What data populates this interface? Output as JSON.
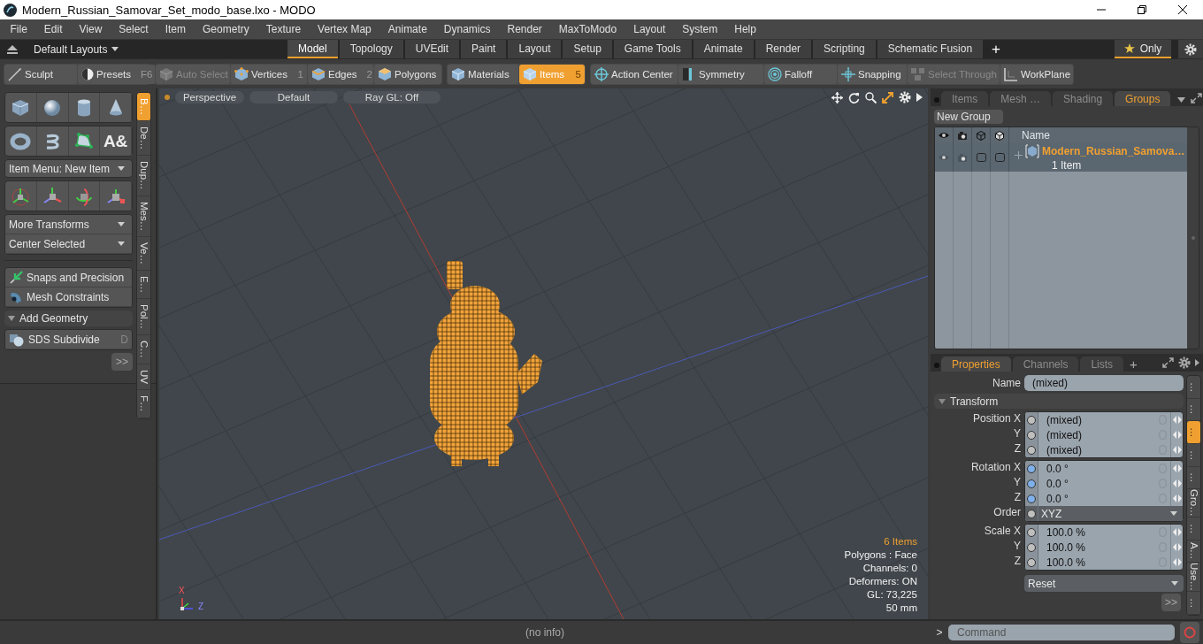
{
  "window": {
    "title": "Modern_Russian_Samovar_Set_modo_base.lxo - MODO"
  },
  "menu": [
    "File",
    "Edit",
    "View",
    "Select",
    "Item",
    "Geometry",
    "Texture",
    "Vertex Map",
    "Animate",
    "Dynamics",
    "Render",
    "MaxToModo",
    "Layout",
    "System",
    "Help"
  ],
  "layout_bar": {
    "layouts": "Default Layouts",
    "tabs": [
      {
        "label": "Model",
        "selected": true
      },
      {
        "label": "Topology",
        "selected": false
      },
      {
        "label": "UVEdit",
        "selected": false
      },
      {
        "label": "Paint",
        "selected": false
      },
      {
        "label": "Layout",
        "selected": false
      },
      {
        "label": "Setup",
        "selected": false
      },
      {
        "label": "Game Tools",
        "selected": false
      },
      {
        "label": "Animate",
        "selected": false
      },
      {
        "label": "Render",
        "selected": false
      },
      {
        "label": "Scripting",
        "selected": false
      },
      {
        "label": "Schematic Fusion",
        "selected": false
      }
    ],
    "add": "+",
    "only": "Only"
  },
  "toolbar": {
    "sculpt": "Sculpt",
    "presets": {
      "label": "Presets",
      "shortcut": "F6"
    },
    "mode_groups": [
      [
        {
          "label": "Auto Select",
          "disabled": true,
          "selected": false
        },
        {
          "label": "Vertices",
          "shortcut": "1",
          "disabled": false,
          "selected": false
        },
        {
          "label": "Edges",
          "shortcut": "2",
          "disabled": false,
          "selected": false
        },
        {
          "label": "Polygons",
          "disabled": false,
          "selected": false
        }
      ],
      [
        {
          "label": "Materials",
          "disabled": false,
          "selected": false
        },
        {
          "label": "Items",
          "shortcut": "5",
          "disabled": false,
          "selected": true
        }
      ],
      [
        {
          "label": "Action Center",
          "disabled": false,
          "selected": false
        },
        {
          "label": "Symmetry",
          "disabled": false,
          "selected": false
        },
        {
          "label": "Falloff",
          "disabled": false,
          "selected": false
        },
        {
          "label": "Snapping",
          "disabled": false,
          "selected": false
        },
        {
          "label": "Select Through",
          "disabled": true,
          "selected": false
        },
        {
          "label": "WorkPlane",
          "disabled": false,
          "selected": false
        }
      ]
    ]
  },
  "tool_panel": {
    "text_tool": "A&",
    "item_menu": "Item Menu: New Item",
    "transform_menus": [
      "More Transforms",
      "Center Selected"
    ],
    "tools": [
      {
        "label": "Snaps and Precision"
      },
      {
        "label": "Mesh Constraints"
      }
    ],
    "section": {
      "label": "Add Geometry",
      "expanded": true
    },
    "section_tools": [
      {
        "label": "SDS Subdivide",
        "shortcut": "D"
      }
    ],
    "more": ">>",
    "side_tabs": [
      {
        "label": "B…",
        "selected": true
      },
      {
        "label": "De…",
        "selected": false
      },
      {
        "label": "Dup…",
        "selected": false
      },
      {
        "label": "Mes…",
        "selected": false
      },
      {
        "label": "Ve…",
        "selected": false
      },
      {
        "label": "E…",
        "selected": false
      },
      {
        "label": "Pol…",
        "selected": false
      },
      {
        "label": "C…",
        "selected": false
      },
      {
        "label": "UV",
        "selected": false
      },
      {
        "label": "F…",
        "selected": false
      }
    ]
  },
  "viewport": {
    "header": [
      "Perspective",
      "Default",
      "Ray GL: Off"
    ],
    "axis_labels": [
      "X",
      "Z"
    ],
    "stats": [
      {
        "text": "6 Items",
        "highlight": true
      },
      {
        "text": "Polygons : Face",
        "highlight": false
      },
      {
        "text": "Channels: 0",
        "highlight": false
      },
      {
        "text": "Deformers: ON",
        "highlight": false
      },
      {
        "text": "GL: 73,225",
        "highlight": false
      },
      {
        "text": "50 mm",
        "highlight": false
      }
    ]
  },
  "groups_panel": {
    "tabs": [
      {
        "label": "Items",
        "selected": false
      },
      {
        "label": "Mesh …",
        "selected": false
      },
      {
        "label": "Shading",
        "selected": false
      },
      {
        "label": "Groups",
        "selected": true
      }
    ],
    "new_group": "New Group",
    "name_column": "Name",
    "rows": [
      {
        "name": "Modern_Russian_Samova…",
        "count": "1 Item",
        "expanded": false
      }
    ]
  },
  "properties_panel": {
    "tabs": [
      {
        "label": "Properties",
        "selected": true
      },
      {
        "label": "Channels",
        "selected": false
      },
      {
        "label": "Lists",
        "selected": false
      }
    ],
    "add": "+",
    "name": {
      "label": "Name",
      "value": "(mixed)"
    },
    "section": {
      "label": "Transform",
      "expanded": true
    },
    "channel_groups": [
      [
        {
          "kind": "value",
          "label": "Position X",
          "value": "(mixed)",
          "keyed": false
        },
        {
          "kind": "value",
          "label": "Y",
          "value": "(mixed)",
          "keyed": false
        },
        {
          "kind": "value",
          "label": "Z",
          "value": "(mixed)",
          "keyed": false
        }
      ],
      [
        {
          "kind": "value",
          "label": "Rotation X",
          "value": "0.0 °",
          "keyed": true
        },
        {
          "kind": "value",
          "label": "Y",
          "value": "0.0 °",
          "keyed": true
        },
        {
          "kind": "value",
          "label": "Z",
          "value": "0.0 °",
          "keyed": true
        },
        {
          "kind": "dropdown",
          "label": "Order",
          "value": "XYZ",
          "keyed": false
        }
      ],
      [
        {
          "kind": "value",
          "label": "Scale X",
          "value": "100.0 %",
          "keyed": false
        },
        {
          "kind": "value",
          "label": "Y",
          "value": "100.0 %",
          "keyed": false
        },
        {
          "kind": "value",
          "label": "Z",
          "value": "100.0 %",
          "keyed": false
        }
      ]
    ],
    "reset": "Reset",
    "more": ">>",
    "side_tabs": [
      {
        "label": "…",
        "selected": false
      },
      {
        "label": "…",
        "selected": false
      },
      {
        "label": "…",
        "selected": true
      },
      {
        "label": "…",
        "selected": false
      },
      {
        "label": "…",
        "selected": false
      },
      {
        "label": "Gro…",
        "selected": false
      },
      {
        "label": "…",
        "selected": false
      },
      {
        "label": "A…",
        "selected": false
      },
      {
        "label": "Use…",
        "selected": false
      },
      {
        "label": "…",
        "selected": false
      }
    ]
  },
  "status_bar": {
    "info": "(no info)",
    "prompt": ">",
    "command_placeholder": "Command"
  }
}
